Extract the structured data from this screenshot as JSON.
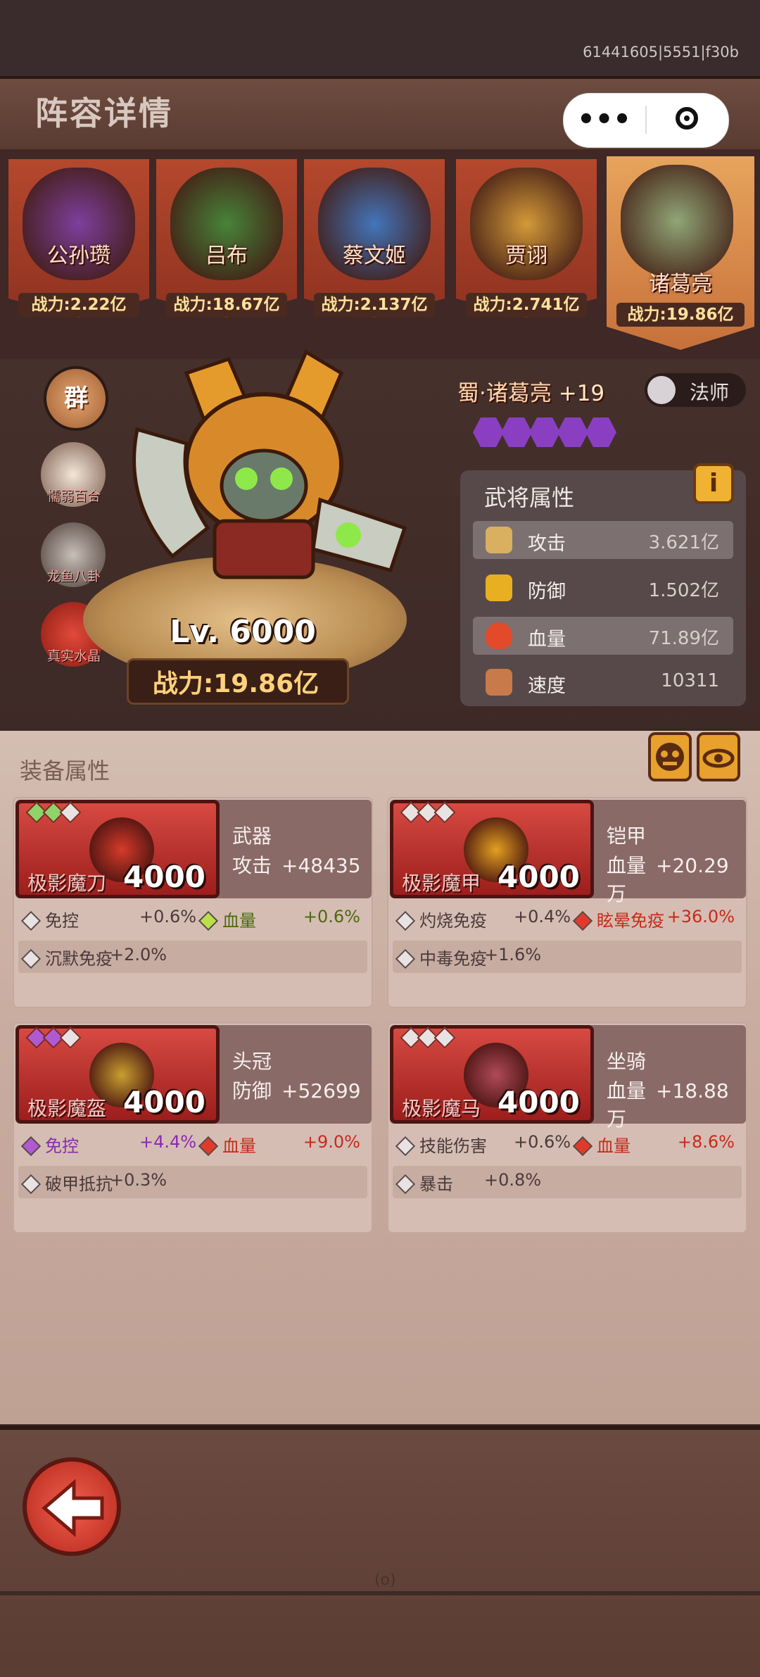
{
  "status": {
    "build_id": "61441605|5551|f30b"
  },
  "header": {
    "title": "阵容详情",
    "capsule": {
      "more": "•••"
    }
  },
  "lineup": [
    {
      "name": "公孙瓒",
      "power": "战力:2.22亿",
      "color": "#7a3fa8"
    },
    {
      "name": "吕布",
      "power": "战力:18.67亿",
      "color": "#3f8a3a"
    },
    {
      "name": "蔡文姬",
      "power": "战力:2.137亿",
      "color": "#3a7ac8"
    },
    {
      "name": "贾诩",
      "power": "战力:2.741亿",
      "color": "#d8a23a"
    },
    {
      "name": "诸葛亮",
      "power": "战力:19.86亿",
      "color": "#8aa87a"
    }
  ],
  "side_buttons": {
    "group": "群",
    "items": [
      {
        "label": "懦弱百合",
        "icon": "lily-icon"
      },
      {
        "label": "龙鱼八卦",
        "icon": "fish-icon"
      },
      {
        "label": "真实水晶",
        "icon": "crystal-icon"
      }
    ]
  },
  "hero": {
    "title": "蜀·诸葛亮",
    "plus": "+19",
    "class": "法师",
    "level": "Lv. 6000",
    "power": "战力:19.86亿",
    "gems": 5
  },
  "attributes": {
    "title": "武将属性",
    "info": "i",
    "rows": [
      {
        "name": "攻击",
        "value": "3.621亿",
        "icon": "sword-icon"
      },
      {
        "name": "防御",
        "value": "1.502亿",
        "icon": "shield-icon"
      },
      {
        "name": "血量",
        "value": "71.89亿",
        "icon": "blood-icon"
      },
      {
        "name": "速度",
        "value": "10311",
        "icon": "boot-icon"
      }
    ]
  },
  "equipment": {
    "title": "装备属性",
    "cards": [
      {
        "item_name": "极影魔刀",
        "level": "4000",
        "slot": "武器",
        "stat": "攻击",
        "stat_value": "+48435",
        "stars": [
          "#8fd36a",
          "#8fd36a",
          "#e8e2e2"
        ],
        "subs": [
          [
            {
              "name": "免控",
              "value": "+0.6%",
              "color": "#e8e2e2"
            },
            {
              "name": "血量",
              "value": "+0.6%",
              "color": "#b7e04a",
              "highlight": true
            }
          ],
          [
            {
              "name": "沉默免疫",
              "value": "+2.0%",
              "color": "#e8e2e2"
            }
          ]
        ]
      },
      {
        "item_name": "极影魔甲",
        "level": "4000",
        "slot": "铠甲",
        "stat": "血量",
        "stat_value": "+20.29万",
        "stars": [
          "#e8e2e2",
          "#e8e2e2",
          "#e8e2e2"
        ],
        "subs": [
          [
            {
              "name": "灼烧免疫",
              "value": "+0.4%",
              "color": "#e8e2e2"
            },
            {
              "name": "眩晕免疫",
              "value": "+36.0%",
              "color": "#e23a2a",
              "highlight": true
            }
          ],
          [
            {
              "name": "中毒免疫",
              "value": "+1.6%",
              "color": "#e8e2e2"
            }
          ]
        ]
      },
      {
        "item_name": "极影魔盔",
        "level": "4000",
        "slot": "头冠",
        "stat": "防御",
        "stat_value": "+52699",
        "stars": [
          "#b05ad2",
          "#b05ad2",
          "#e8e2e2"
        ],
        "subs": [
          [
            {
              "name": "免控",
              "value": "+4.4%",
              "color": "#b05ad2",
              "highlight": true
            },
            {
              "name": "血量",
              "value": "+9.0%",
              "color": "#e23a2a",
              "highlight": true
            }
          ],
          [
            {
              "name": "破甲抵抗",
              "value": "+0.3%",
              "color": "#e8e2e2"
            }
          ]
        ]
      },
      {
        "item_name": "极影魔马",
        "level": "4000",
        "slot": "坐骑",
        "stat": "血量",
        "stat_value": "+18.88万",
        "stars": [
          "#e8e2e2",
          "#e8e2e2",
          "#e8e2e2"
        ],
        "subs": [
          [
            {
              "name": "技能伤害",
              "value": "+0.6%",
              "color": "#e8e2e2"
            },
            {
              "name": "血量",
              "value": "+8.6%",
              "color": "#e23a2a",
              "highlight": true
            }
          ],
          [
            {
              "name": "暴击",
              "value": "+0.8%",
              "color": "#e8e2e2"
            }
          ]
        ]
      }
    ]
  },
  "footer": {
    "knot": "(o)"
  }
}
